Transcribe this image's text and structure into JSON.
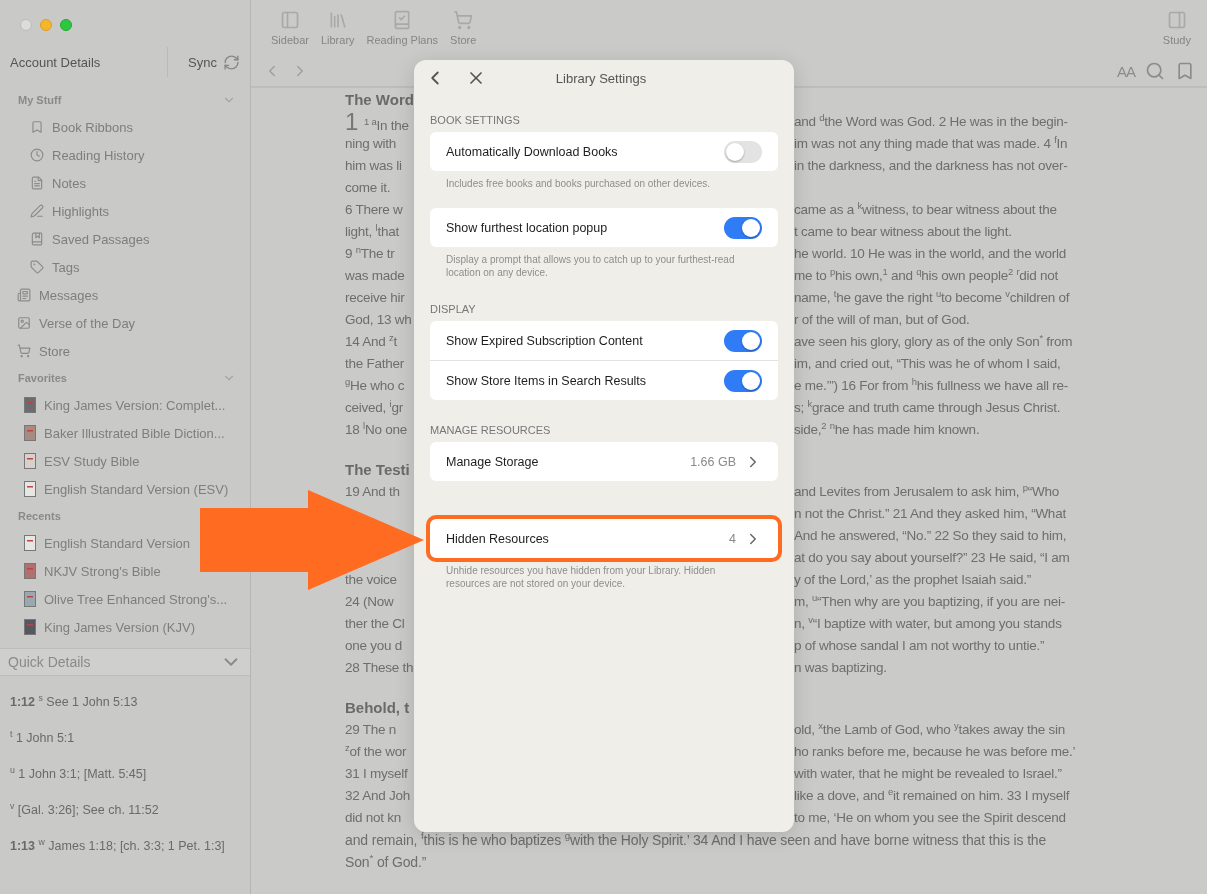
{
  "sidebar": {
    "account": "Account Details",
    "sync": "Sync",
    "my_stuff": {
      "title": "My Stuff",
      "expanded": true,
      "items": [
        "Book Ribbons",
        "Reading History",
        "Notes",
        "Highlights",
        "Saved Passages",
        "Tags"
      ]
    },
    "top_items": [
      "Messages",
      "Verse of the Day",
      "Store"
    ],
    "favorites": {
      "title": "Favorites",
      "expanded": true,
      "items": [
        "King James Version: Complet...",
        "Baker Illustrated Bible Diction...",
        "ESV Study Bible",
        "English Standard Version (ESV)"
      ]
    },
    "recents": {
      "title": "Recents",
      "items": [
        "English Standard Version",
        "NKJV Strong's Bible",
        "Olive Tree Enhanced Strong's...",
        "King James Version (KJV)"
      ]
    }
  },
  "quick_details": {
    "title": "Quick Details",
    "expanded": true,
    "entries": [
      "**1:12** $^{s}$ See 1 John 5:13",
      "$^{t}$ 1 John 5:1",
      "$^{u}$ 1 John 3:1; [Matt. 5:45]",
      "$^{v}$ [Gal. 3:26]; See ch. 11:52",
      "**1:13** $^{w}$ James 1:18; [ch. 3:3; 1 Pet. 1:3]"
    ]
  },
  "toolbar": {
    "items": [
      "Sidebar",
      "Library",
      "Reading Plans",
      "Store"
    ],
    "study": "Study",
    "text_size": "AA"
  },
  "reader": {
    "lines": [
      {
        "kind": "heading",
        "text": "The Word"
      },
      {
        "kind": "chapter",
        "chapter": "1",
        "left": "$^{1 a}$In the",
        "right": "and $^{d}$the Word was God. 2 He was in the begin-"
      },
      {
        "kind": "split",
        "left": "ning with",
        "right": "im was not any thing made that was made. 4 $^{f}$In"
      },
      {
        "kind": "split",
        "left": "him was li",
        "right": "in the darkness, and the darkness has not over-"
      },
      {
        "kind": "split",
        "left": "come it."
      },
      {
        "kind": "split",
        "left": "6 There w",
        "right": "came as a $^{k}$witness, to bear witness about the"
      },
      {
        "kind": "split",
        "left": "light, $^{l}$that",
        "right": "t came to bear witness about the light."
      },
      {
        "kind": "split",
        "left": "9 $^{n}$The tr",
        "right": "he world. 10 He was in the world, and the world"
      },
      {
        "kind": "split",
        "left": "was made",
        "right": "me to $^{p}$his own,$^{1}$ and $^{q}$his own people$^{2}$ $^{r}$did not"
      },
      {
        "kind": "split",
        "left": "receive hir",
        "right": "name, $^{t}$he gave the right $^{u}$to become $^{v}$children of"
      },
      {
        "kind": "split",
        "left": "God, 13 wh",
        "right": "r of the will of man, but of God."
      },
      {
        "kind": "split",
        "left": "14 And $^{z}$t",
        "right": "ave seen his glory, glory as of the only Son$^{*}$ from"
      },
      {
        "kind": "split",
        "left": "the Father",
        "right": "im, and cried out, “This was he of whom I said,"
      },
      {
        "kind": "split",
        "left": "$^{g}$He who c",
        "right": "e me.’”) 16 For from $^{h}$his fullness we have all re-"
      },
      {
        "kind": "split",
        "left": "ceived, $^{i}$gr",
        "right": "s; $^{k}$grace and truth came through Jesus Christ."
      },
      {
        "kind": "split",
        "left": "18 $^{l}$No one",
        "right": "side,$^{2}$ $^{n}$he has made him known."
      },
      {
        "kind": "heading",
        "text": "The Testi"
      },
      {
        "kind": "split",
        "left": "19 And th",
        "right": "and Levites from Jerusalem to ask him, $^{p}$“Who"
      },
      {
        "kind": "split",
        "right": "n not the Christ.” 21 And they asked him, “What"
      },
      {
        "kind": "split",
        "right": "And he answered, “No.” 22 So they said to him,"
      },
      {
        "kind": "split",
        "right": "at do you say about yourself?” 23 He said, “I am"
      },
      {
        "kind": "split",
        "left": "the voice",
        "right": "y of the Lord,’ as the prophet Isaiah said.”"
      },
      {
        "kind": "split",
        "left": "24 (Now",
        "right": "m, $^{u}$“Then why are you baptizing, if you are nei-"
      },
      {
        "kind": "split",
        "left": "ther the Cl",
        "right": "n, $^{v}$“I baptize with water, but among you stands"
      },
      {
        "kind": "split",
        "left": "one you d",
        "right": "p of whose sandal I am not worthy to untie.”"
      },
      {
        "kind": "split",
        "left": "28 These th",
        "right": "n was baptizing."
      },
      {
        "kind": "heading",
        "text": "Behold, t"
      },
      {
        "kind": "split",
        "left": "29 The n",
        "right": "old, $^{x}$the Lamb of God, who $^{y}$takes away the sin"
      },
      {
        "kind": "split",
        "left": "$^{z}$of the wor",
        "right": "ho ranks before me, because he was before me.’"
      },
      {
        "kind": "split",
        "left": "31 I myself",
        "right": "with water, that he might be revealed to Israel.”"
      },
      {
        "kind": "split",
        "left": "32 And Joh",
        "right": "like a dove, and $^{e}$it remained on him. 33 I myself"
      },
      {
        "kind": "split",
        "left": "did not kn",
        "right": "to me, ‘He on whom you see the Spirit descend"
      },
      {
        "kind": "full",
        "text": "and remain, $^{f}$this is he who baptizes $^{g}$with the Holy Spirit.’ 34 And I have seen and have borne witness that this is the"
      },
      {
        "kind": "full",
        "text": "Son$^{*}$ of God.”"
      }
    ]
  },
  "dialog": {
    "title": "Library Settings",
    "sections": [
      {
        "header": "BOOK SETTINGS",
        "groups": [
          {
            "rows": [
              {
                "kind": "toggle",
                "label": "Automatically Download Books",
                "on": false
              }
            ],
            "footer": "Includes free books and books purchased on other devices."
          },
          {
            "rows": [
              {
                "kind": "toggle",
                "label": "Show furthest location popup",
                "on": true
              }
            ],
            "footer": "Display a prompt that allows you to catch up to your furthest-read location on any device."
          }
        ]
      },
      {
        "header": "DISPLAY",
        "groups": [
          {
            "rows": [
              {
                "kind": "toggle",
                "label": "Show Expired Subscription Content",
                "on": true
              },
              {
                "kind": "toggle",
                "label": "Show Store Items in Search Results",
                "on": true
              }
            ]
          }
        ]
      },
      {
        "header": "MANAGE RESOURCES",
        "groups": [
          {
            "rows": [
              {
                "kind": "link",
                "label": "Manage Storage",
                "value": "1.66 GB",
                "highlighted": false
              }
            ]
          },
          {
            "rows": [
              {
                "kind": "link",
                "label": "Hidden Resources",
                "value": "4",
                "highlighted": true
              }
            ],
            "footer": "Unhide resources you have hidden from your Library. Hidden resources are not stored on your device."
          }
        ]
      }
    ]
  }
}
